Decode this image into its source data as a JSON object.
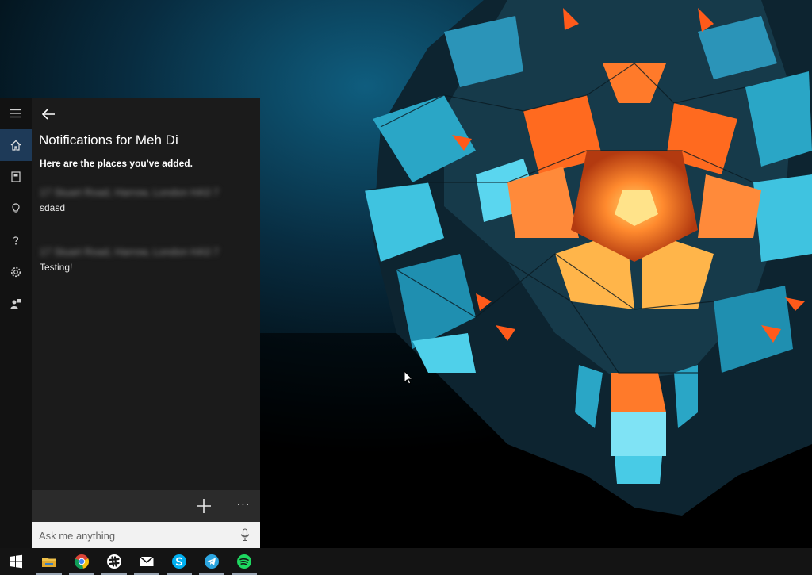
{
  "cortana": {
    "title": "Notifications for Meh Di",
    "subtitle": "Here are the places you've added.",
    "places": [
      {
        "address": "17 Stuart Road, Harrow, London HA3 7",
        "note": "sdasd"
      },
      {
        "address": "17 Stuart Road, Harrow, London HA3 7",
        "note": "Testing!"
      }
    ],
    "rail": [
      "menu-icon",
      "home-icon",
      "notebook-icon",
      "lightbulb-icon",
      "help-icon",
      "settings-icon",
      "feedback-icon"
    ],
    "search_placeholder": "Ask me anything",
    "more_label": "···"
  },
  "taskbar": {
    "items": [
      "windows-start-icon",
      "file-explorer-icon",
      "chrome-icon",
      "slack-icon",
      "mail-icon",
      "skype-icon",
      "telegram-icon",
      "spotify-icon"
    ]
  },
  "colors": {
    "accent": "#1e3a58",
    "panel": "#1b1b1b",
    "rail": "#121212",
    "taskbar": "#141414",
    "wallpaper_orange": "#ff7a2a",
    "wallpaper_cyan": "#36b8d8"
  }
}
